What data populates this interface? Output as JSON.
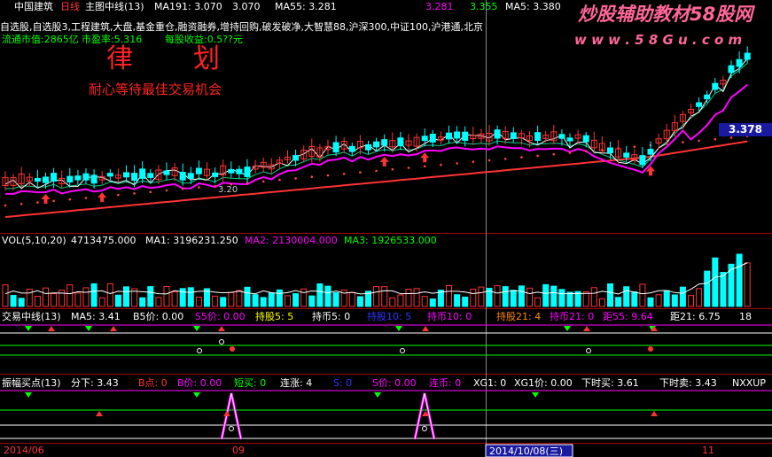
{
  "colors": {
    "background": "#000000",
    "white": "#ffffff",
    "yellow": "#ffff00",
    "magenta": "#ff00ff",
    "green": "#00ff00",
    "cyan": "#00ffff",
    "red": "#ff3333",
    "blue": "#3333ff",
    "orange": "#ff8800",
    "separator": "#aa0000",
    "price_tag": "#1a1aa0"
  },
  "header": {
    "stock_name": "中国建筑",
    "period": "日线",
    "indicator": "主图中线(13)",
    "ma191": "MA191: 3.070",
    "v2": "3.070",
    "ma55": "MA55: 3.281",
    "v4": "3.281",
    "v5": "3.355",
    "ma5": "MA5: 3.380",
    "concepts": "自选股,自选股3,工程建筑,大盘,基金重仓,融资融券,增持回购,破发破净,大智慧88,沪深300,中证100,沪港通,北京",
    "market_value": "流通市值:2865亿",
    "pe": "市盈率:5.316",
    "eps": "每股收益:0.5??元"
  },
  "watermark": {
    "title": "炒股辅助教材58股网",
    "url": "w w w . 5 8 G u . c o m"
  },
  "overlay": {
    "calligraphy_1": "律",
    "calligraphy_2": "划",
    "slogan": "耐心等待最佳交易机会"
  },
  "main_chart": {
    "price_tag": "3.378",
    "left_label": "3.20"
  },
  "volume_panel": {
    "title": "VOL(5,10,20)",
    "vol": "4713475.000",
    "ma1": "MA1: 3196231.250",
    "ma2": "MA2: 2130004.000",
    "ma3": "MA3: 1926533.000"
  },
  "trade_panel": {
    "title": "交易中线(13)",
    "ma5": "MA5: 3.41",
    "b5": "B5价: 0.00",
    "s5": "S5价: 0.00",
    "hold5": "持股5: 5",
    "cash5": "持币5: 0",
    "hold10": "持股10: 5",
    "cash10": "持币10: 0",
    "hold21": "持股21: 4",
    "cash21": "持币21: 0",
    "dist55": "距55: 9.64",
    "dist21": "距21: 6.75",
    "tail": "18"
  },
  "amp_panel": {
    "title": "振幅买点(13)",
    "fenxia": "分下: 3.43",
    "b": "B点: 0",
    "bprice": "B价: 0.00",
    "short_buy": "短买: 0",
    "lianzhang": "连涨: 4",
    "s": "S: 0",
    "sprice": "S价: 0.00",
    "lianbi": "连币: 0",
    "xg1": "XG1: 0",
    "xg1price": "XG1价: 0.00",
    "xiashimai": "下时买: 3.61",
    "xiashimai2": "下时卖: 3.43",
    "nxxup": "NXXUP"
  },
  "date_axis": {
    "year_month": "2014/06",
    "month": "09",
    "cursor_date": "2014/10/08(三)",
    "month2": "11"
  }
}
